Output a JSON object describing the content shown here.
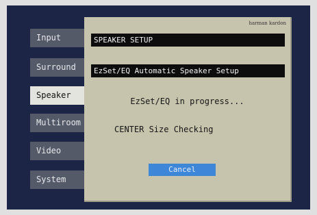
{
  "menu": {
    "items": [
      {
        "label": "Input"
      },
      {
        "label": "Surround"
      },
      {
        "label": "Speaker"
      },
      {
        "label": "Multiroom"
      },
      {
        "label": "Video"
      },
      {
        "label": "System"
      }
    ],
    "selected": "Speaker"
  },
  "panel": {
    "brand": "harman kardon",
    "title": "SPEAKER SETUP",
    "subtitle": "EzSet/EQ Automatic Speaker Setup",
    "progress_text": "EzSet/EQ in progress...",
    "status_text": "CENTER Size Checking",
    "cancel_label": "Cancel"
  },
  "colors": {
    "screen_background": "#1c2546",
    "panel_background": "#c6c4ac",
    "menu_item": "#545a68",
    "menu_item_selected": "#e4e4de",
    "cancel_button": "#3e87d8"
  }
}
